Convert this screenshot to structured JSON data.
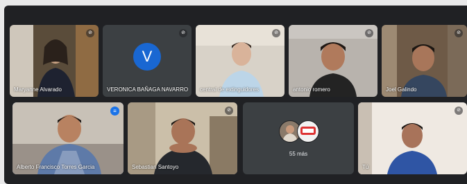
{
  "participants": [
    {
      "name": "Maryanne Alvarado",
      "muted": true
    },
    {
      "name": "VERONICA BAÑAGA NAVARRO",
      "avatar_letter": "V",
      "muted": true
    },
    {
      "name": "central de extinguidores",
      "muted": true
    },
    {
      "name": "antonio romero",
      "muted": true
    },
    {
      "name": "Joel Galindo",
      "muted": true
    },
    {
      "name": "Alberto Francisco Torres Garcia",
      "speaking": true
    },
    {
      "name": "Sebastian Santoyo",
      "muted": true
    },
    {
      "name": "Tú",
      "muted": true
    }
  ],
  "more_tile": {
    "label": "55 más"
  },
  "colors": {
    "background": "#202124",
    "tile": "#3c4043",
    "avatar": "#1967d2",
    "speaking": "#1a73e8"
  },
  "icons": {
    "muted": "mic-off-icon",
    "speaking": "audio-level-icon"
  }
}
